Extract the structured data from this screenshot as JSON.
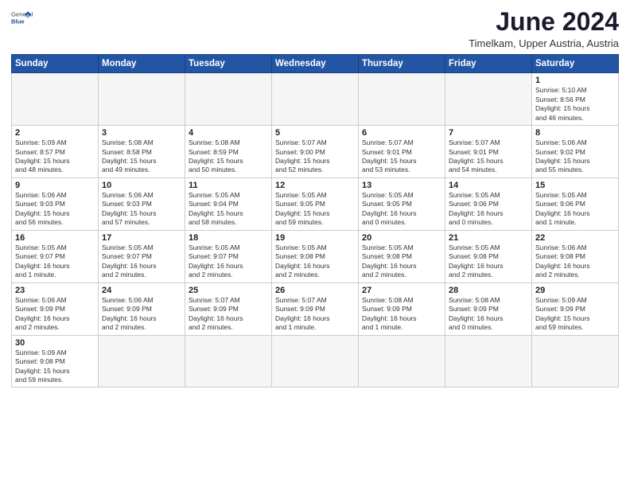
{
  "header": {
    "logo_general": "General",
    "logo_blue": "Blue",
    "month": "June 2024",
    "location": "Timelkam, Upper Austria, Austria"
  },
  "weekdays": [
    "Sunday",
    "Monday",
    "Tuesday",
    "Wednesday",
    "Thursday",
    "Friday",
    "Saturday"
  ],
  "weeks": [
    [
      {
        "day": "",
        "info": "",
        "empty": true
      },
      {
        "day": "",
        "info": "",
        "empty": true
      },
      {
        "day": "",
        "info": "",
        "empty": true
      },
      {
        "day": "",
        "info": "",
        "empty": true
      },
      {
        "day": "",
        "info": "",
        "empty": true
      },
      {
        "day": "",
        "info": "",
        "empty": true
      },
      {
        "day": "1",
        "info": "Sunrise: 5:10 AM\nSunset: 8:56 PM\nDaylight: 15 hours\nand 46 minutes."
      }
    ],
    [
      {
        "day": "2",
        "info": "Sunrise: 5:09 AM\nSunset: 8:57 PM\nDaylight: 15 hours\nand 48 minutes."
      },
      {
        "day": "3",
        "info": "Sunrise: 5:08 AM\nSunset: 8:58 PM\nDaylight: 15 hours\nand 49 minutes."
      },
      {
        "day": "4",
        "info": "Sunrise: 5:08 AM\nSunset: 8:59 PM\nDaylight: 15 hours\nand 50 minutes."
      },
      {
        "day": "5",
        "info": "Sunrise: 5:07 AM\nSunset: 9:00 PM\nDaylight: 15 hours\nand 52 minutes."
      },
      {
        "day": "6",
        "info": "Sunrise: 5:07 AM\nSunset: 9:01 PM\nDaylight: 15 hours\nand 53 minutes."
      },
      {
        "day": "7",
        "info": "Sunrise: 5:07 AM\nSunset: 9:01 PM\nDaylight: 15 hours\nand 54 minutes."
      },
      {
        "day": "8",
        "info": "Sunrise: 5:06 AM\nSunset: 9:02 PM\nDaylight: 15 hours\nand 55 minutes."
      }
    ],
    [
      {
        "day": "9",
        "info": "Sunrise: 5:06 AM\nSunset: 9:03 PM\nDaylight: 15 hours\nand 56 minutes."
      },
      {
        "day": "10",
        "info": "Sunrise: 5:06 AM\nSunset: 9:03 PM\nDaylight: 15 hours\nand 57 minutes."
      },
      {
        "day": "11",
        "info": "Sunrise: 5:05 AM\nSunset: 9:04 PM\nDaylight: 15 hours\nand 58 minutes."
      },
      {
        "day": "12",
        "info": "Sunrise: 5:05 AM\nSunset: 9:05 PM\nDaylight: 15 hours\nand 59 minutes."
      },
      {
        "day": "13",
        "info": "Sunrise: 5:05 AM\nSunset: 9:05 PM\nDaylight: 16 hours\nand 0 minutes."
      },
      {
        "day": "14",
        "info": "Sunrise: 5:05 AM\nSunset: 9:06 PM\nDaylight: 16 hours\nand 0 minutes."
      },
      {
        "day": "15",
        "info": "Sunrise: 5:05 AM\nSunset: 9:06 PM\nDaylight: 16 hours\nand 1 minute."
      }
    ],
    [
      {
        "day": "16",
        "info": "Sunrise: 5:05 AM\nSunset: 9:07 PM\nDaylight: 16 hours\nand 1 minute."
      },
      {
        "day": "17",
        "info": "Sunrise: 5:05 AM\nSunset: 9:07 PM\nDaylight: 16 hours\nand 2 minutes."
      },
      {
        "day": "18",
        "info": "Sunrise: 5:05 AM\nSunset: 9:07 PM\nDaylight: 16 hours\nand 2 minutes."
      },
      {
        "day": "19",
        "info": "Sunrise: 5:05 AM\nSunset: 9:08 PM\nDaylight: 16 hours\nand 2 minutes."
      },
      {
        "day": "20",
        "info": "Sunrise: 5:05 AM\nSunset: 9:08 PM\nDaylight: 16 hours\nand 2 minutes."
      },
      {
        "day": "21",
        "info": "Sunrise: 5:05 AM\nSunset: 9:08 PM\nDaylight: 16 hours\nand 2 minutes."
      },
      {
        "day": "22",
        "info": "Sunrise: 5:06 AM\nSunset: 9:08 PM\nDaylight: 16 hours\nand 2 minutes."
      }
    ],
    [
      {
        "day": "23",
        "info": "Sunrise: 5:06 AM\nSunset: 9:09 PM\nDaylight: 16 hours\nand 2 minutes."
      },
      {
        "day": "24",
        "info": "Sunrise: 5:06 AM\nSunset: 9:09 PM\nDaylight: 16 hours\nand 2 minutes."
      },
      {
        "day": "25",
        "info": "Sunrise: 5:07 AM\nSunset: 9:09 PM\nDaylight: 16 hours\nand 2 minutes."
      },
      {
        "day": "26",
        "info": "Sunrise: 5:07 AM\nSunset: 9:09 PM\nDaylight: 16 hours\nand 1 minute."
      },
      {
        "day": "27",
        "info": "Sunrise: 5:08 AM\nSunset: 9:09 PM\nDaylight: 16 hours\nand 1 minute."
      },
      {
        "day": "28",
        "info": "Sunrise: 5:08 AM\nSunset: 9:09 PM\nDaylight: 16 hours\nand 0 minutes."
      },
      {
        "day": "29",
        "info": "Sunrise: 5:09 AM\nSunset: 9:09 PM\nDaylight: 15 hours\nand 59 minutes."
      }
    ],
    [
      {
        "day": "30",
        "info": "Sunrise: 5:09 AM\nSunset: 9:08 PM\nDaylight: 15 hours\nand 59 minutes."
      },
      {
        "day": "",
        "info": "",
        "empty": true
      },
      {
        "day": "",
        "info": "",
        "empty": true
      },
      {
        "day": "",
        "info": "",
        "empty": true
      },
      {
        "day": "",
        "info": "",
        "empty": true
      },
      {
        "day": "",
        "info": "",
        "empty": true
      },
      {
        "day": "",
        "info": "",
        "empty": true
      }
    ]
  ]
}
